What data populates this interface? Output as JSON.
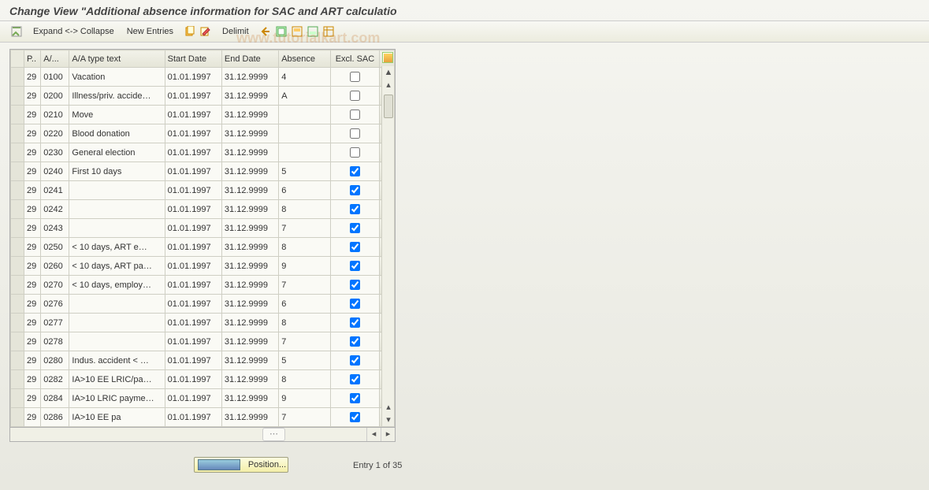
{
  "title": "Change View \"Additional absence information for SAC and ART calculatio",
  "watermark": "www.tutorialkart.com",
  "toolbar": {
    "expand_collapse": "Expand <-> Collapse",
    "new_entries": "New Entries",
    "delimit": "Delimit"
  },
  "columns": {
    "p": "P..",
    "a": "A/...",
    "txt": "A/A type text",
    "start": "Start Date",
    "end": "End Date",
    "absence": "Absence",
    "excl": "Excl. SAC"
  },
  "rows": [
    {
      "p": "29",
      "a": "0100",
      "txt": "Vacation",
      "start": "01.01.1997",
      "end": "31.12.9999",
      "abs": "4",
      "chk": false
    },
    {
      "p": "29",
      "a": "0200",
      "txt": "Illness/priv. accide…",
      "start": "01.01.1997",
      "end": "31.12.9999",
      "abs": "A",
      "chk": false
    },
    {
      "p": "29",
      "a": "0210",
      "txt": "Move",
      "start": "01.01.1997",
      "end": "31.12.9999",
      "abs": "",
      "chk": false
    },
    {
      "p": "29",
      "a": "0220",
      "txt": "Blood donation",
      "start": "01.01.1997",
      "end": "31.12.9999",
      "abs": "",
      "chk": false
    },
    {
      "p": "29",
      "a": "0230",
      "txt": "General election",
      "start": "01.01.1997",
      "end": "31.12.9999",
      "abs": "",
      "chk": false
    },
    {
      "p": "29",
      "a": "0240",
      "txt": "First 10 days",
      "start": "01.01.1997",
      "end": "31.12.9999",
      "abs": "5",
      "chk": true
    },
    {
      "p": "29",
      "a": "0241",
      "txt": "",
      "start": "01.01.1997",
      "end": "31.12.9999",
      "abs": "6",
      "chk": true
    },
    {
      "p": "29",
      "a": "0242",
      "txt": "",
      "start": "01.01.1997",
      "end": "31.12.9999",
      "abs": "8",
      "chk": true
    },
    {
      "p": "29",
      "a": "0243",
      "txt": "",
      "start": "01.01.1997",
      "end": "31.12.9999",
      "abs": "7",
      "chk": true
    },
    {
      "p": "29",
      "a": "0250",
      "txt": "< 10 days, ART e…",
      "start": "01.01.1997",
      "end": "31.12.9999",
      "abs": "8",
      "chk": true
    },
    {
      "p": "29",
      "a": "0260",
      "txt": "< 10 days, ART pa…",
      "start": "01.01.1997",
      "end": "31.12.9999",
      "abs": "9",
      "chk": true
    },
    {
      "p": "29",
      "a": "0270",
      "txt": "< 10 days, employ…",
      "start": "01.01.1997",
      "end": "31.12.9999",
      "abs": "7",
      "chk": true
    },
    {
      "p": "29",
      "a": "0276",
      "txt": "",
      "start": "01.01.1997",
      "end": "31.12.9999",
      "abs": "6",
      "chk": true
    },
    {
      "p": "29",
      "a": "0277",
      "txt": "",
      "start": "01.01.1997",
      "end": "31.12.9999",
      "abs": "8",
      "chk": true
    },
    {
      "p": "29",
      "a": "0278",
      "txt": "",
      "start": "01.01.1997",
      "end": "31.12.9999",
      "abs": "7",
      "chk": true
    },
    {
      "p": "29",
      "a": "0280",
      "txt": "Indus. accident < …",
      "start": "01.01.1997",
      "end": "31.12.9999",
      "abs": "5",
      "chk": true
    },
    {
      "p": "29",
      "a": "0282",
      "txt": "IA>10 EE LRIC/pa…",
      "start": "01.01.1997",
      "end": "31.12.9999",
      "abs": "8",
      "chk": true
    },
    {
      "p": "29",
      "a": "0284",
      "txt": "IA>10 LRIC payme…",
      "start": "01.01.1997",
      "end": "31.12.9999",
      "abs": "9",
      "chk": true
    },
    {
      "p": "29",
      "a": "0286",
      "txt": "IA>10 EE pa",
      "start": "01.01.1997",
      "end": "31.12.9999",
      "abs": "7",
      "chk": true
    }
  ],
  "footer": {
    "position_label": "Position...",
    "entry_label": "Entry 1 of 35"
  }
}
